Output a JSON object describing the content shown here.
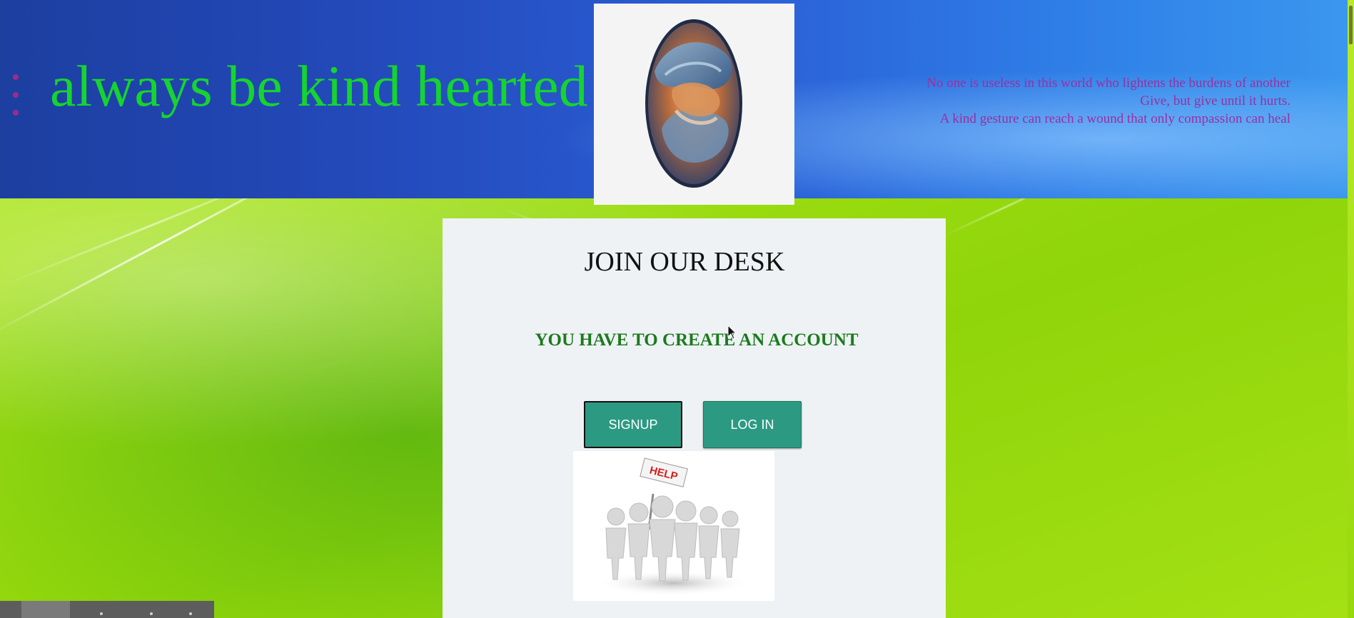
{
  "header": {
    "motto": "always be kind hearted",
    "quotes": [
      "No one is useless in this world who lightens the burdens of another",
      "Give, but give until it hurts.",
      "A kind gesture can reach a wound that only compassion can heal"
    ]
  },
  "card": {
    "title": "JOIN OUR DESK",
    "subtitle": "YOU HAVE TO CREATE AN ACCOUNT",
    "signup_label": "SIGNUP",
    "login_label": "LOG IN",
    "help_sign_text": "HELP"
  },
  "colors": {
    "motto": "#16d430",
    "quotes": "#9b2fa0",
    "subtitle": "#1c7a1c",
    "button": "#2c9a82",
    "header_blue": "#2348b8",
    "background_green": "#9ede12"
  }
}
